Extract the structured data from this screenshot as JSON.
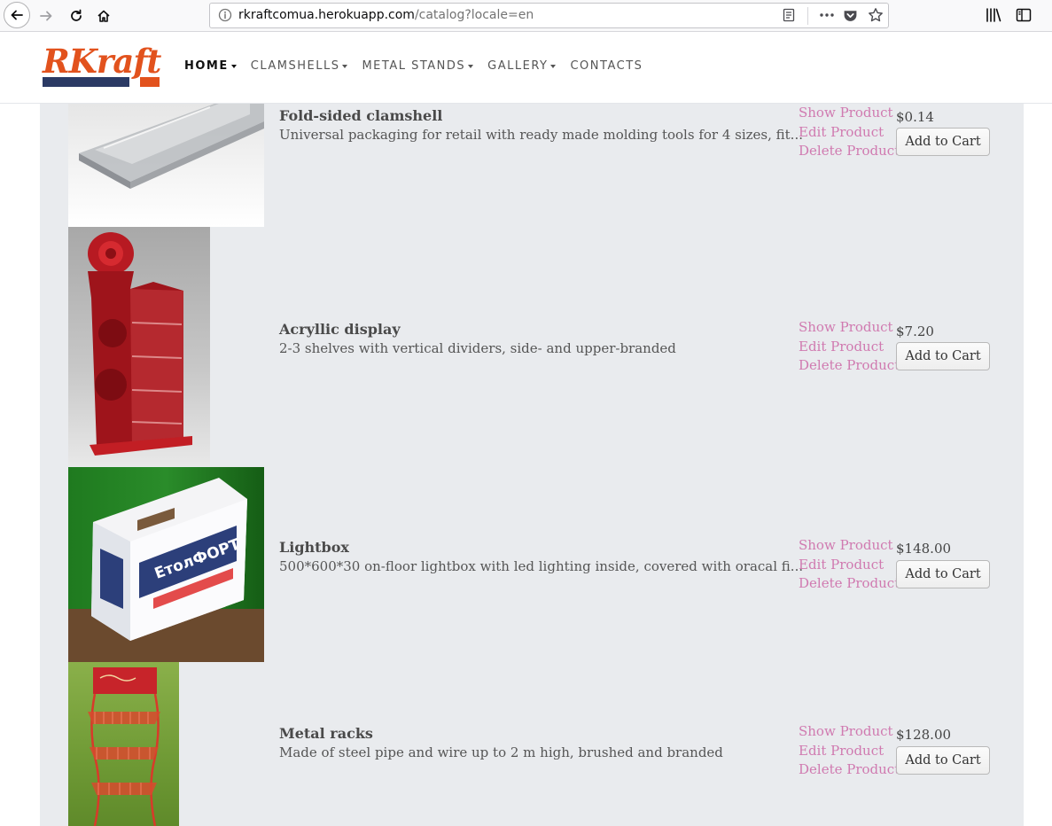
{
  "browser": {
    "url_host": "rkraftcomua.herokuapp.com",
    "url_path": "/catalog?locale=en"
  },
  "header": {
    "logo_text": "RKraft",
    "nav": [
      {
        "label": "HOME",
        "dropdown": true,
        "active": true
      },
      {
        "label": "CLAMSHELLS",
        "dropdown": true,
        "active": false
      },
      {
        "label": "METAL STANDS",
        "dropdown": true,
        "active": false
      },
      {
        "label": "GALLERY",
        "dropdown": true,
        "active": false
      },
      {
        "label": "CONTACTS",
        "dropdown": false,
        "active": false
      }
    ]
  },
  "catalog": {
    "actions": {
      "show": "Show Product",
      "edit": "Edit Product",
      "delete": "Delete Product",
      "cart": "Add to Cart"
    },
    "products": [
      {
        "name": "Fold-sided clamshell",
        "description": "Universal packaging for retail with ready made molding tools for 4 sizes, fit...",
        "price": "$0.14"
      },
      {
        "name": "Acryllic display",
        "description": "2-3 shelves with vertical dividers, side- and upper-branded",
        "price": "$7.20"
      },
      {
        "name": "Lightbox",
        "description": "500*600*30 on-floor lightbox with led lighting inside, covered with oracal fi...",
        "price": "$148.00",
        "image_text": {
          "brand": "ЕтолФОРТ"
        }
      },
      {
        "name": "Metal racks",
        "description": "Made of steel pipe and wire up to 2 m high, brushed and branded",
        "price": "$128.00"
      }
    ]
  },
  "colors": {
    "link_pink": "#d07ab0",
    "panel_bg": "#e9ebee",
    "logo_orange": "#e2521d",
    "logo_navy": "#2b3a64"
  }
}
